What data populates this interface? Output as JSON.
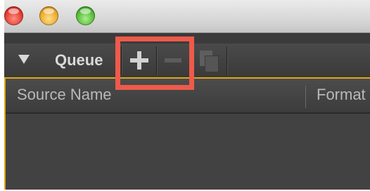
{
  "window": {
    "buttons": [
      "close",
      "minimize",
      "maximize"
    ]
  },
  "panel": {
    "title": "Queue",
    "toolbar": {
      "add_icon": "plus-icon",
      "remove_icon": "minus-icon",
      "duplicate_icon": "duplicate-icon"
    }
  },
  "table": {
    "columns": [
      "Source Name",
      "Format"
    ]
  },
  "colors": {
    "accent_border": "#e3a512",
    "highlight": "#ee5a4a",
    "panel_bg": "#3b3b3b"
  }
}
